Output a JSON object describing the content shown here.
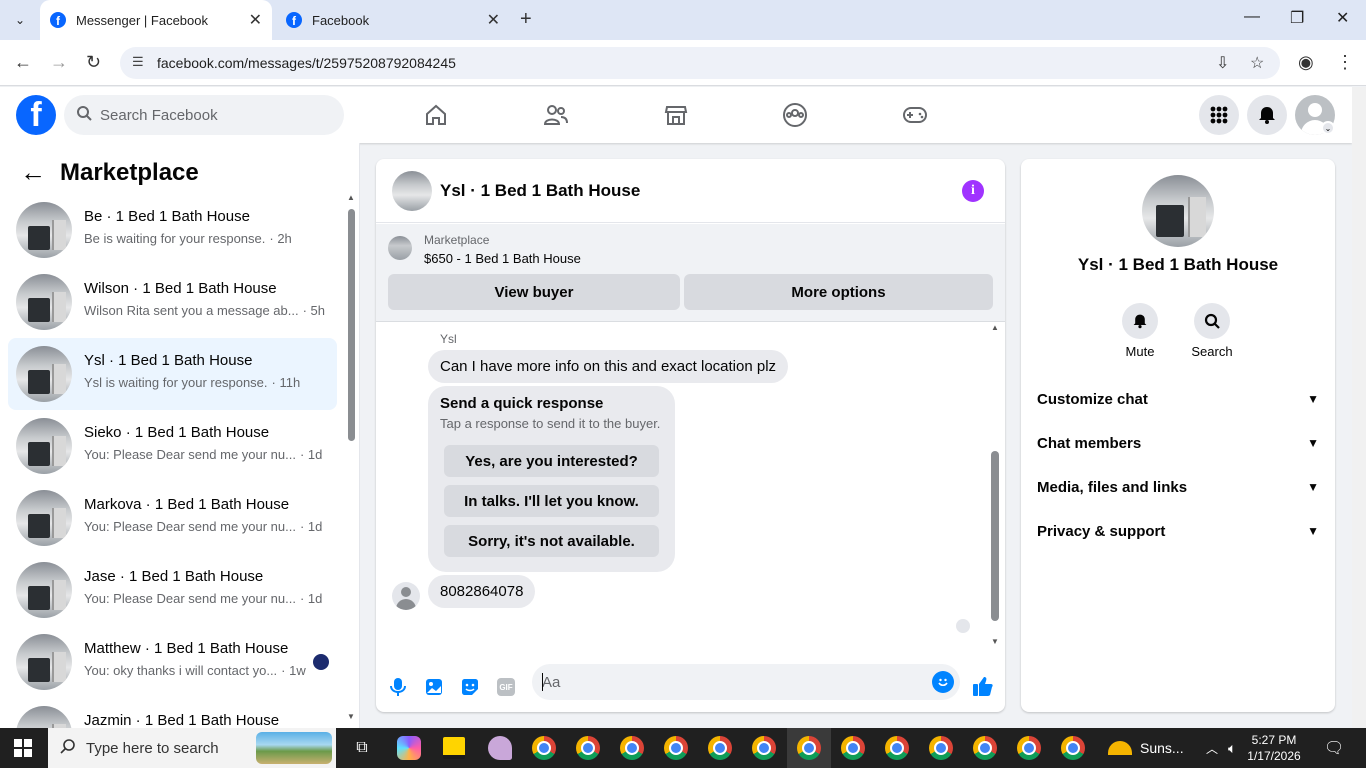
{
  "browser": {
    "tabs": [
      {
        "title": "Messenger | Facebook",
        "active": true
      },
      {
        "title": "Facebook",
        "active": false
      }
    ],
    "url": "facebook.com/messages/t/25975208792084245"
  },
  "fb": {
    "logo": "f",
    "search_placeholder": "Search Facebook",
    "nav_icons": [
      "home-icon",
      "friends-icon",
      "marketplace-icon",
      "groups-icon",
      "gaming-icon"
    ],
    "right_icons": [
      "menu-grid-icon",
      "notifications-bell-icon"
    ]
  },
  "sidebar": {
    "title": "Marketplace",
    "conversations": [
      {
        "name": "Be · 1 Bed 1 Bath House",
        "preview": "Be is waiting for your response.",
        "time": "· 2h"
      },
      {
        "name": "Wilson · 1 Bed 1 Bath House",
        "preview": "Wilson Rita sent you a message ab...",
        "time": "· 5h"
      },
      {
        "name": "Ysl · 1 Bed 1 Bath House",
        "preview": "Ysl is waiting for your response.",
        "time": "· 11h"
      },
      {
        "name": "Sieko · 1 Bed 1 Bath House",
        "preview": "You: Please Dear send me your nu...",
        "time": "· 1d"
      },
      {
        "name": "Markova · 1 Bed 1 Bath House",
        "preview": "You: Please Dear send me your nu...",
        "time": "· 1d"
      },
      {
        "name": "Jase · 1 Bed 1 Bath House",
        "preview": "You: Please Dear send me your nu...",
        "time": "· 1d"
      },
      {
        "name": "Matthew · 1 Bed 1 Bath House",
        "preview": "You: oky thanks i will contact yo...",
        "time": "· 1w"
      },
      {
        "name": "Jazmin · 1 Bed 1 Bath House",
        "preview": "",
        "time": ""
      }
    ]
  },
  "chat": {
    "title": "Ysl · 1 Bed 1 Bath House",
    "marketplace_label": "Marketplace",
    "listing": "$650 - 1 Bed 1 Bath House",
    "view_buyer": "View buyer",
    "more_options": "More options",
    "sender": "Ysl",
    "message1": "Can I have more info on this and exact location plz",
    "quick_title": "Send a quick response",
    "quick_sub": "Tap a response to send it to the buyer.",
    "quick_replies": [
      "Yes, are you interested?",
      "In talks. I'll let you know.",
      "Sorry, it's not available."
    ],
    "message2": "8082864078",
    "composer_placeholder": "Aa",
    "gif_label": "GIF"
  },
  "details": {
    "name": "Ysl · 1 Bed 1 Bath House",
    "actions": [
      {
        "label": "Mute",
        "icon": "bell-icon"
      },
      {
        "label": "Search",
        "icon": "search-icon"
      }
    ],
    "sections": [
      "Customize chat",
      "Chat members",
      "Media, files and links",
      "Privacy & support"
    ]
  },
  "taskbar": {
    "search_placeholder": "Type here to search",
    "weather": "Suns...",
    "time": "5:27 PM",
    "date": "1/17/2026"
  },
  "colors": {
    "fb_blue": "#0866ff",
    "selected_bg": "#ebf5ff",
    "messenger_blue": "#0084ff",
    "info_purple": "#a033ff"
  }
}
